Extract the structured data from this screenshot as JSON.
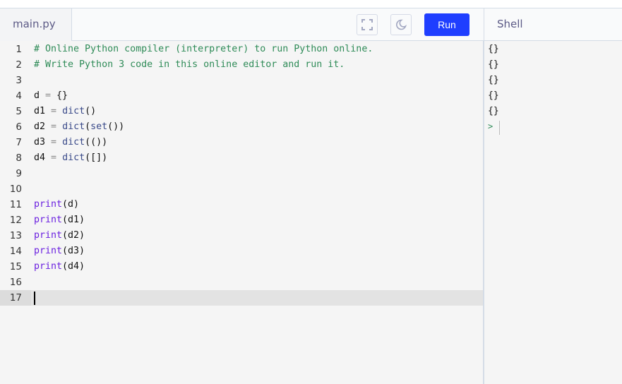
{
  "tab": {
    "filename": "main.py"
  },
  "toolbar": {
    "fullscreen_icon": "fullscreen-icon",
    "theme_icon": "moon-icon",
    "run_label": "Run",
    "run_color": "#1f3eff"
  },
  "shell": {
    "title": "Shell",
    "output": [
      "{}",
      "{}",
      "{}",
      "{}",
      "{}"
    ],
    "prompt": ">"
  },
  "editor": {
    "active_line": 17,
    "lines": [
      {
        "num": "1",
        "text": "# Online Python compiler (interpreter) to run Python online."
      },
      {
        "num": "2",
        "text": "# Write Python 3 code in this online editor and run it."
      },
      {
        "num": "3",
        "text": ""
      },
      {
        "num": "4",
        "text": "d = {}"
      },
      {
        "num": "5",
        "text": "d1 = dict()"
      },
      {
        "num": "6",
        "text": "d2 = dict(set())"
      },
      {
        "num": "7",
        "text": "d3 = dict(())"
      },
      {
        "num": "8",
        "text": "d4 = dict([])"
      },
      {
        "num": "9",
        "text": ""
      },
      {
        "num": "10",
        "text": ""
      },
      {
        "num": "11",
        "text": "print(d)"
      },
      {
        "num": "12",
        "text": "print(d1)"
      },
      {
        "num": "13",
        "text": "print(d2)"
      },
      {
        "num": "14",
        "text": "print(d3)"
      },
      {
        "num": "15",
        "text": "print(d4)"
      },
      {
        "num": "16",
        "text": ""
      },
      {
        "num": "17",
        "text": ""
      }
    ]
  }
}
